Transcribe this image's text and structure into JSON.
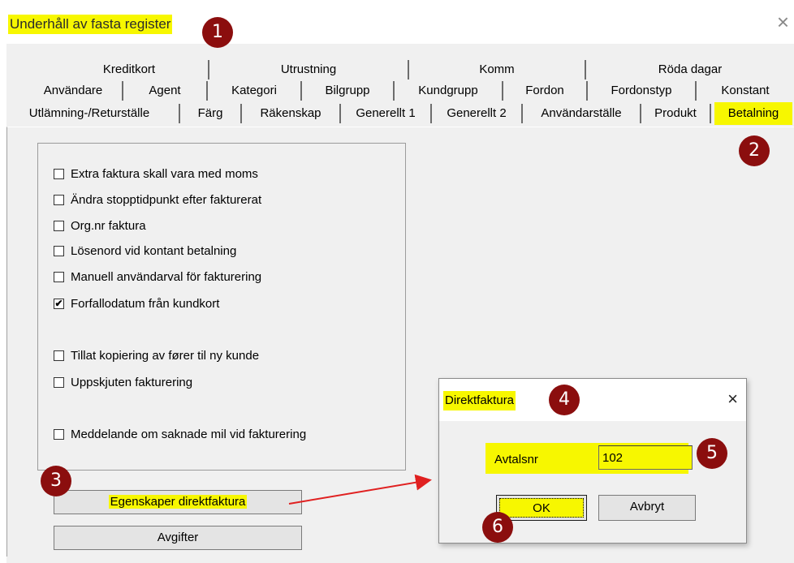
{
  "window": {
    "title": "Underhåll av fasta register",
    "close_glyph": "×"
  },
  "tabs": {
    "row1": [
      "Kreditkort",
      "Utrustning",
      "Komm",
      "Röda dagar"
    ],
    "row2": [
      "Användare",
      "Agent",
      "Kategori",
      "Bilgrupp",
      "Kundgrupp",
      "Fordon",
      "Fordonstyp",
      "Konstant"
    ],
    "row3": [
      "Utlämning-/Returställe",
      "Färg",
      "Räkenskap",
      "Generellt 1",
      "Generellt 2",
      "Användarställe",
      "Produkt",
      "Betalning"
    ],
    "active": "Betalning"
  },
  "options": [
    {
      "label": "Extra faktura skall vara med moms",
      "checked": false
    },
    {
      "label": "Ändra stopptidpunkt efter fakturerat",
      "checked": false
    },
    {
      "label": "Org.nr faktura",
      "checked": false
    },
    {
      "label": "Lösenord vid kontant betalning",
      "checked": false
    },
    {
      "label": "Manuell användarval för fakturering",
      "checked": false
    },
    {
      "label": "Forfallodatum från kundkort",
      "checked": true
    },
    {
      "label": "Tillat kopiering av fører til ny kunde",
      "checked": false
    },
    {
      "label": "Uppskjuten fakturering",
      "checked": false
    },
    {
      "label": "Meddelande om saknade mil vid fakturering",
      "checked": false
    }
  ],
  "buttons": {
    "direct_invoice": "Egenskaper direktfaktura",
    "fees": "Avgifter"
  },
  "dialog": {
    "title": "Direktfaktura",
    "close_glyph": "×",
    "field_label": "Avtalsnr",
    "field_value": "102",
    "ok": "OK",
    "cancel": "Avbryt"
  },
  "markers": [
    "1",
    "2",
    "3",
    "4",
    "5",
    "6"
  ],
  "colors": {
    "highlight": "#f7f700",
    "marker": "#8b0e0e",
    "arrow": "#e02020",
    "window_bg": "#f0f0f0"
  },
  "icons": {
    "check": "✔"
  }
}
